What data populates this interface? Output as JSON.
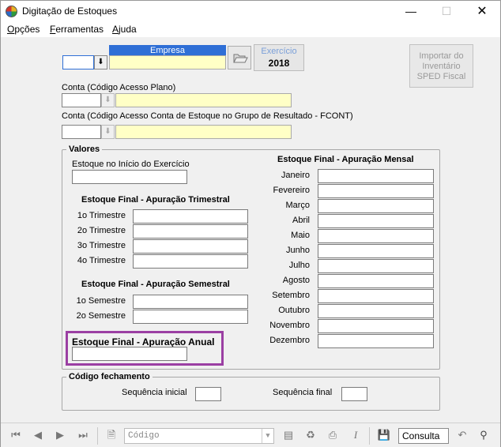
{
  "window": {
    "title": "Digitação de Estoques"
  },
  "menu": [
    {
      "label_u": "O",
      "label_rest": "pções"
    },
    {
      "label_u": "F",
      "label_rest": "erramentas"
    },
    {
      "label_u": "A",
      "label_rest": "juda"
    }
  ],
  "empresa": {
    "header": "Empresa",
    "code": "",
    "name": ""
  },
  "exercicio": {
    "label": "Exercício",
    "value": "2018"
  },
  "import_button": {
    "line1": "Importar do",
    "line2": "Inventário",
    "line3": "SPED Fiscal"
  },
  "conta1": {
    "label": "Conta (Código Acesso Plano)",
    "code": "",
    "name": ""
  },
  "conta2": {
    "label": "Conta (Código Acesso Conta de Estoque no Grupo de Resultado - FCONT)",
    "code": "",
    "name": ""
  },
  "valores": {
    "title": "Valores",
    "inicio_label": "Estoque no Início do Exercício",
    "inicio_value": "",
    "trimestral": {
      "title": "Estoque Final - Apuração Trimestral",
      "rows": [
        "1o Trimestre",
        "2o Trimestre",
        "3o Trimestre",
        "4o Trimestre"
      ]
    },
    "semestral": {
      "title": "Estoque Final - Apuração Semestral",
      "rows": [
        "1o Semestre",
        "2o Semestre"
      ]
    },
    "anual": {
      "title": "Estoque Final - Apuração Anual",
      "value": ""
    },
    "mensal": {
      "title": "Estoque Final - Apuração Mensal",
      "rows": [
        "Janeiro",
        "Fevereiro",
        "Março",
        "Abril",
        "Maio",
        "Junho",
        "Julho",
        "Agosto",
        "Setembro",
        "Outubro",
        "Novembro",
        "Dezembro"
      ]
    }
  },
  "fechamento": {
    "title": "Código fechamento",
    "seq_inicial_label": "Sequência inicial",
    "seq_final_label": "Sequência final",
    "seq_inicial": "",
    "seq_final": ""
  },
  "toolbar": {
    "combo_placeholder": "Código",
    "mode": "Consulta"
  },
  "colors": {
    "accent": "#2f6fd6",
    "highlight": "#9b3fa3",
    "field_yellow": "#ffffc6"
  }
}
